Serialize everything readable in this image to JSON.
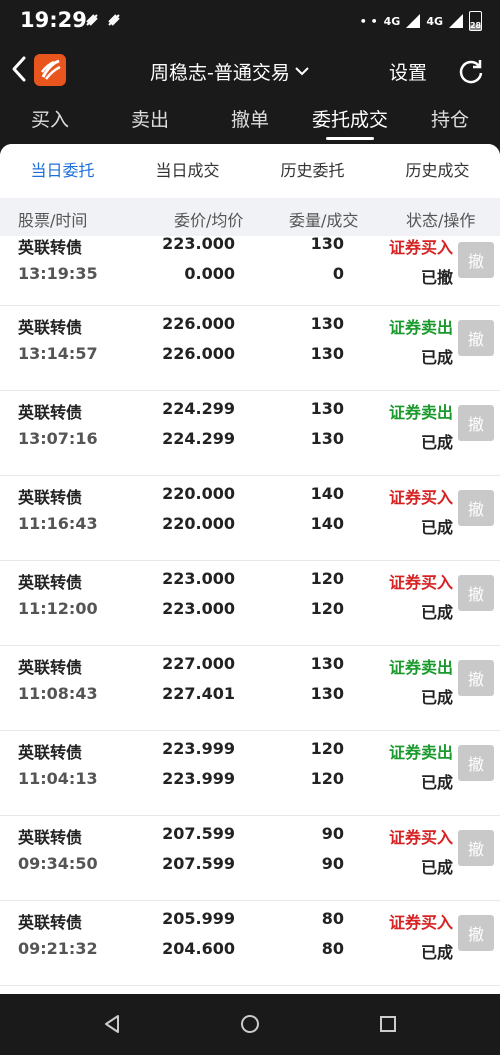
{
  "status_bar": {
    "time": "19:29",
    "net1": "4G",
    "net2": "4G",
    "battery": "28"
  },
  "header": {
    "title": "周稳志-普通交易",
    "settings_label": "设置"
  },
  "main_tabs": [
    {
      "label": "买入"
    },
    {
      "label": "卖出"
    },
    {
      "label": "撤单"
    },
    {
      "label": "委托成交"
    },
    {
      "label": "持仓"
    }
  ],
  "sub_tabs": [
    {
      "label": "当日委托"
    },
    {
      "label": "当日成交"
    },
    {
      "label": "历史委托"
    },
    {
      "label": "历史成交"
    }
  ],
  "columns": {
    "stock_time": "股票/时间",
    "price_avg": "委价/均价",
    "qty_filled": "委量/成交",
    "status_action": "状态/操作"
  },
  "orders": [
    {
      "name": "英联转债",
      "time": "13:19:35",
      "price": "223.000",
      "avg": "0.000",
      "qty": "130",
      "filled": "0",
      "side": "证券买入",
      "side_type": "buy",
      "status": "已撤",
      "action": "撤"
    },
    {
      "name": "英联转债",
      "time": "13:14:57",
      "price": "226.000",
      "avg": "226.000",
      "qty": "130",
      "filled": "130",
      "side": "证券卖出",
      "side_type": "sell",
      "status": "已成",
      "action": "撤"
    },
    {
      "name": "英联转债",
      "time": "13:07:16",
      "price": "224.299",
      "avg": "224.299",
      "qty": "130",
      "filled": "130",
      "side": "证券卖出",
      "side_type": "sell",
      "status": "已成",
      "action": "撤"
    },
    {
      "name": "英联转债",
      "time": "11:16:43",
      "price": "220.000",
      "avg": "220.000",
      "qty": "140",
      "filled": "140",
      "side": "证券买入",
      "side_type": "buy",
      "status": "已成",
      "action": "撤"
    },
    {
      "name": "英联转债",
      "time": "11:12:00",
      "price": "223.000",
      "avg": "223.000",
      "qty": "120",
      "filled": "120",
      "side": "证券买入",
      "side_type": "buy",
      "status": "已成",
      "action": "撤"
    },
    {
      "name": "英联转债",
      "time": "11:08:43",
      "price": "227.000",
      "avg": "227.401",
      "qty": "130",
      "filled": "130",
      "side": "证券卖出",
      "side_type": "sell",
      "status": "已成",
      "action": "撤"
    },
    {
      "name": "英联转债",
      "time": "11:04:13",
      "price": "223.999",
      "avg": "223.999",
      "qty": "120",
      "filled": "120",
      "side": "证券卖出",
      "side_type": "sell",
      "status": "已成",
      "action": "撤"
    },
    {
      "name": "英联转债",
      "time": "09:34:50",
      "price": "207.599",
      "avg": "207.599",
      "qty": "90",
      "filled": "90",
      "side": "证券买入",
      "side_type": "buy",
      "status": "已成",
      "action": "撤"
    },
    {
      "name": "英联转债",
      "time": "09:21:32",
      "price": "205.999",
      "avg": "204.600",
      "qty": "80",
      "filled": "80",
      "side": "证券买入",
      "side_type": "buy",
      "status": "已成",
      "action": "撤"
    }
  ],
  "colors": {
    "buy": "#d62222",
    "sell": "#1a9a2c",
    "active_tab": "#1e6fd9",
    "logo": "#e8561e"
  },
  "icons": {
    "back": "chevron-left-icon",
    "logo": "app-logo-icon",
    "dropdown": "chevron-down-icon",
    "refresh": "refresh-icon",
    "nav_back": "triangle-back-icon",
    "nav_home": "circle-home-icon",
    "nav_recent": "square-recent-icon"
  }
}
